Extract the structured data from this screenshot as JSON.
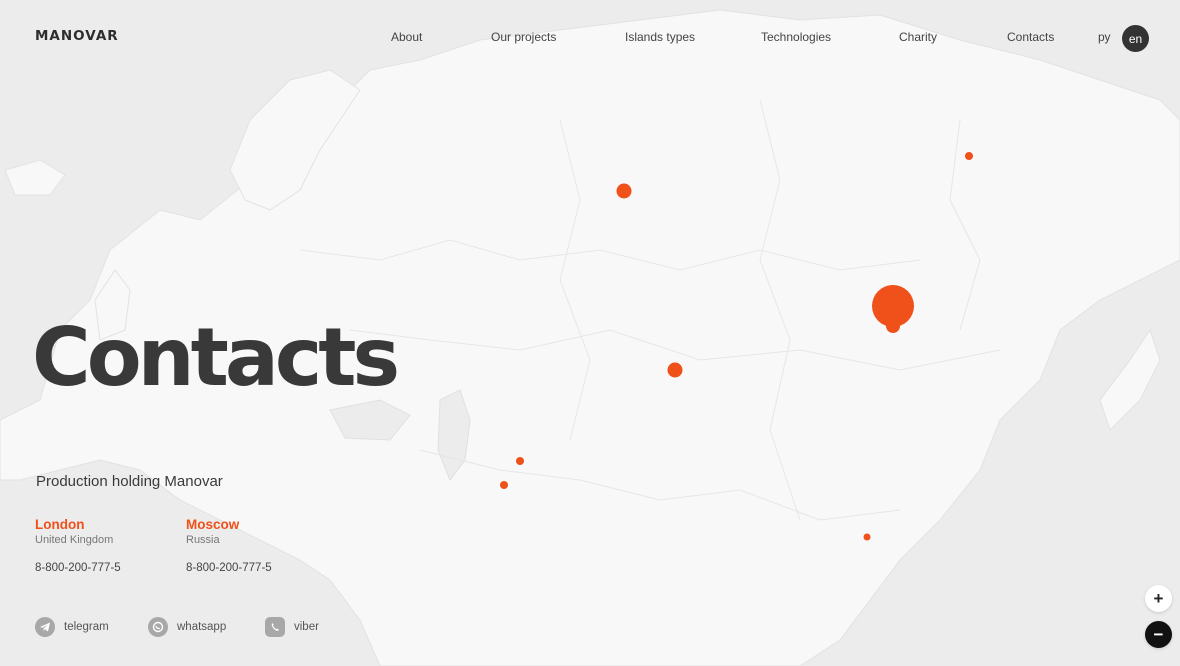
{
  "brand": "MANOVAR",
  "nav": [
    {
      "label": "About"
    },
    {
      "label": "Our projects"
    },
    {
      "label": "Islands types"
    },
    {
      "label": "Technologies"
    },
    {
      "label": "Charity"
    },
    {
      "label": "Contacts"
    }
  ],
  "lang": {
    "ru": "ру",
    "en": "en"
  },
  "page_title": "Contacts",
  "company": "Production holding Manovar",
  "offices": [
    {
      "city": "London",
      "country": "United Kingdom",
      "phone": "8-800-200-777-5"
    },
    {
      "city": "Moscow",
      "country": "Russia",
      "phone": "8-800-200-777-5"
    }
  ],
  "social": [
    {
      "label": "telegram",
      "icon": "telegram-icon"
    },
    {
      "label": "whatsapp",
      "icon": "whatsapp-icon"
    },
    {
      "label": "viber",
      "icon": "viber-icon"
    }
  ],
  "zoom": {
    "in": "+",
    "out": "−"
  },
  "colors": {
    "accent": "#f0501a",
    "map_land": "#f7f7f7",
    "map_water": "#ececec"
  }
}
